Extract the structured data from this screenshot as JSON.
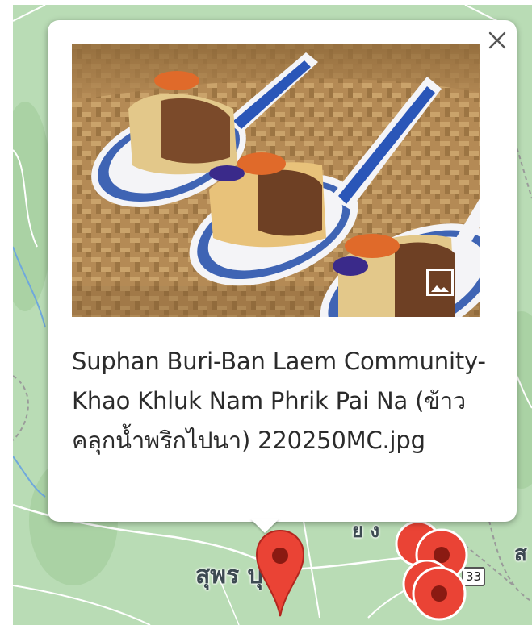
{
  "map": {
    "labels": {
      "suphan_buri": "สุพร   บุรี",
      "top_partial": "ย ง",
      "right_partial": "ส"
    },
    "road_shield": "33"
  },
  "info_window": {
    "close_icon": "close-icon",
    "photo_alt": "Khao Khluk Nam Phrik Pai Na served on blue-and-white porcelain spoons on a woven bamboo tray",
    "expand_icon": "image-expand-icon",
    "caption": "Suphan Buri-Ban Laem Community-Khao Khluk Nam Phrik Pai Na (ข้าวคลุกน้ำพริกไปนา) 220250MC.jpg"
  },
  "colors": {
    "map_green": "#b9dcb5",
    "marker_red": "#ea4335",
    "marker_dot": "#8a1a12"
  }
}
